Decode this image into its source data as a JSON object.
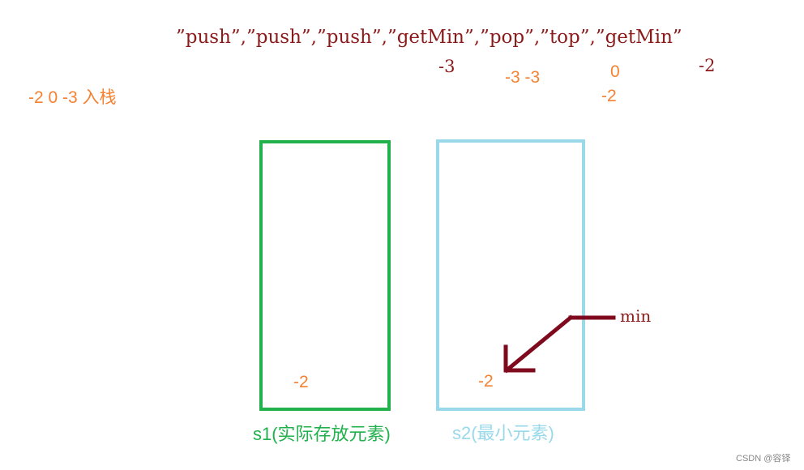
{
  "operations_line": "”push”,”push”,”push”,”getMin”,”pop”,”top”,”getMin”",
  "push_note": "-2 0 -3  入栈",
  "results": {
    "getmin_1": "-3",
    "pop_values": "-3 -3",
    "top_value": "0",
    "top_min": "-2",
    "getmin_2": "-2"
  },
  "stacks": {
    "s1": {
      "label": "s1(实际存放元素)",
      "value": "-2",
      "color": "#22b14c"
    },
    "s2": {
      "label": "s2(最小元素)",
      "value": "-2",
      "color": "#99d9ea"
    }
  },
  "pointer": {
    "label": "min",
    "color": "#7f0a1e"
  },
  "colors": {
    "operations": "#8b1a1a",
    "values": "#f58233"
  },
  "watermark": "CSDN @容铎"
}
